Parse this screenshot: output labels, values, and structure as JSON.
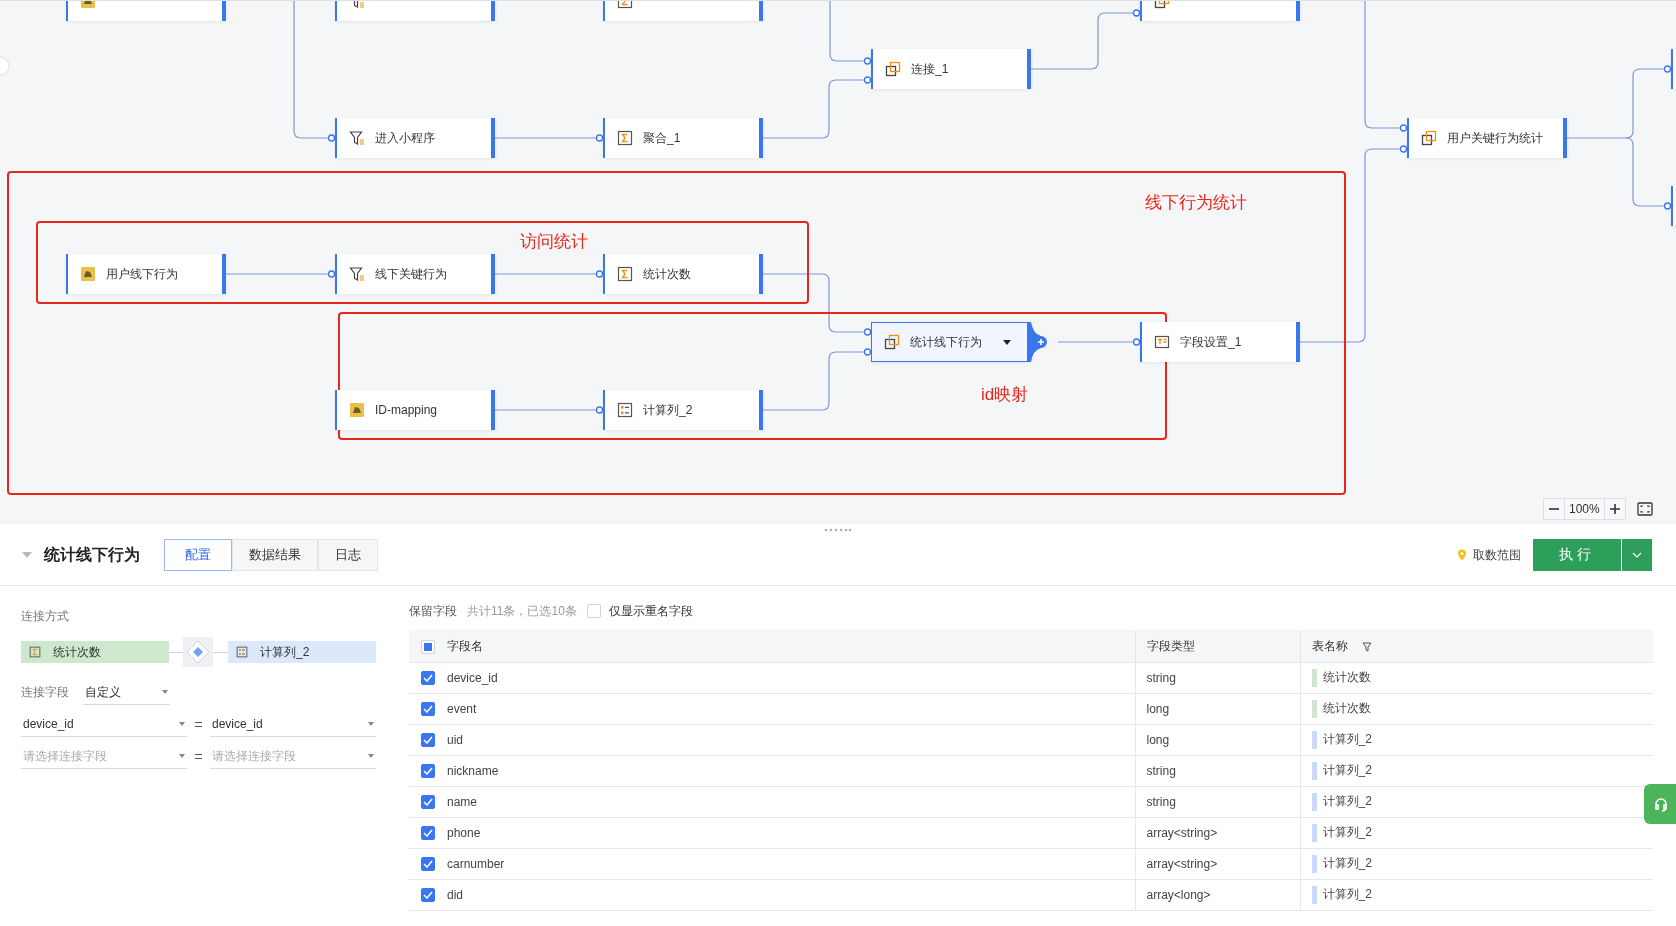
{
  "canvas": {
    "nodes": [
      {
        "kind": "source",
        "selected": false
      },
      {
        "kind": "filter",
        "selected": false
      },
      {
        "kind": "aggregate",
        "selected": false
      },
      {
        "kind": "join",
        "selected": false
      },
      {
        "label": "连接_1",
        "kind": "join",
        "selected": false
      },
      {
        "label": "进入小程序",
        "kind": "filter",
        "selected": false
      },
      {
        "label": "聚合_1",
        "kind": "aggregate",
        "selected": false
      },
      {
        "label": "用户关键行为统计",
        "kind": "join",
        "selected": false
      },
      {
        "label": "用户线下行为",
        "kind": "source",
        "selected": false
      },
      {
        "label": "线下关键行为",
        "kind": "filter",
        "selected": false
      },
      {
        "label": "统计次数",
        "kind": "aggregate",
        "selected": false
      },
      {
        "label": "统计线下行为",
        "kind": "join",
        "selected": true
      },
      {
        "label": "字段设置_1",
        "kind": "fields",
        "selected": false
      },
      {
        "label": "ID-mapping",
        "kind": "source",
        "selected": false
      },
      {
        "label": "计算列_2",
        "kind": "calc",
        "selected": false
      },
      {
        "kind": "edge",
        "selected": false
      },
      {
        "kind": "edge",
        "selected": false
      }
    ],
    "annotations": [
      {
        "label": "线下行为统计"
      },
      {
        "label": "访问统计"
      },
      {
        "label": "id映射"
      }
    ],
    "zoom": "100%"
  },
  "panel": {
    "title": "统计线下行为",
    "tabs": [
      {
        "label": "配置",
        "selected": true
      },
      {
        "label": "数据结果",
        "selected": false
      },
      {
        "label": "日志",
        "selected": false
      }
    ],
    "range_link": "取数范围",
    "run_button": "执行",
    "join": {
      "section_label": "连接方式",
      "left": {
        "label": "统计次数",
        "kind": "aggregate",
        "color": "#cde8cd"
      },
      "right": {
        "label": "计算列_2",
        "kind": "calc",
        "color": "#dce8fb"
      },
      "field_label": "连接字段",
      "field_mode": "自定义",
      "pairs": [
        {
          "left": "device_id",
          "right": "device_id"
        },
        {
          "left_placeholder": "请选择连接字段",
          "right_placeholder": "请选择连接字段"
        }
      ]
    },
    "fields": {
      "title": "保留字段",
      "summary": "共计11条，已选10条",
      "duplicate_only": {
        "label": "仅显示重名字段",
        "checked": false
      },
      "select_all_partial": true,
      "columns": [
        "字段名",
        "字段类型",
        "表名称"
      ],
      "rows": [
        {
          "name": "device_id",
          "type": "string",
          "table": "统计次数",
          "color": "#cde8cd",
          "checked": true
        },
        {
          "name": "event",
          "type": "long",
          "table": "统计次数",
          "color": "#cde8cd",
          "checked": true
        },
        {
          "name": "uid",
          "type": "long",
          "table": "计算列_2",
          "color": "#c9d8fb",
          "checked": true
        },
        {
          "name": "nickname",
          "type": "string",
          "table": "计算列_2",
          "color": "#c9d8fb",
          "checked": true
        },
        {
          "name": "name",
          "type": "string",
          "table": "计算列_2",
          "color": "#c9d8fb",
          "checked": true
        },
        {
          "name": "phone",
          "type": "array<string>",
          "table": "计算列_2",
          "color": "#c9d8fb",
          "checked": true
        },
        {
          "name": "carnumber",
          "type": "array<string>",
          "table": "计算列_2",
          "color": "#c9d8fb",
          "checked": true
        },
        {
          "name": "did",
          "type": "array<long>",
          "table": "计算列_2",
          "color": "#c9d8fb",
          "checked": true
        }
      ]
    }
  }
}
